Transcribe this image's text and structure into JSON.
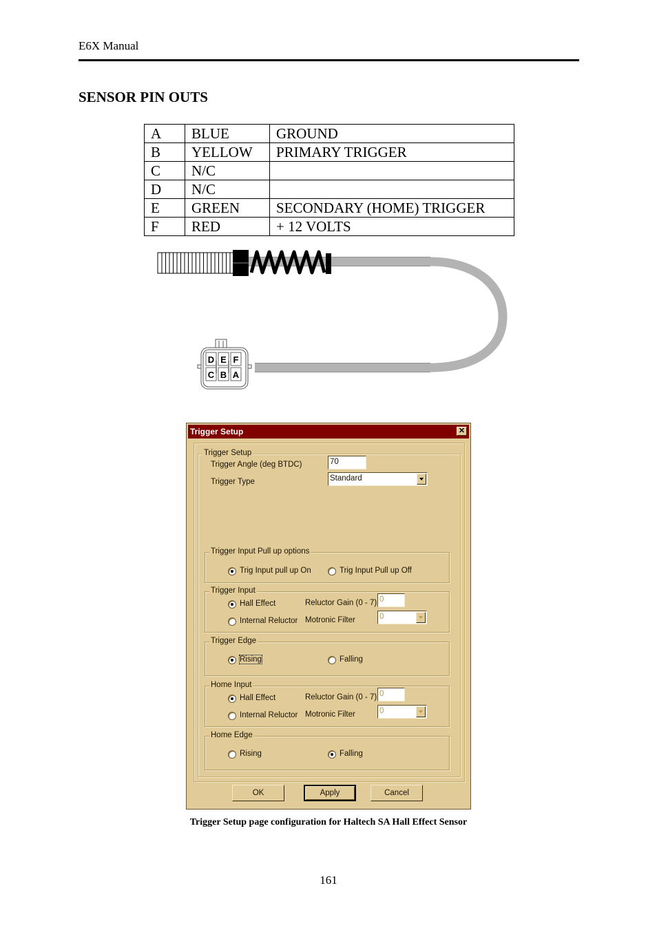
{
  "header": {
    "title": "E6X Manual"
  },
  "section": {
    "title": "SENSOR PIN OUTS"
  },
  "pinout_table": {
    "rows": [
      {
        "pin": "A",
        "color": "BLUE",
        "function": "GROUND"
      },
      {
        "pin": "B",
        "color": "YELLOW",
        "function": "PRIMARY TRIGGER"
      },
      {
        "pin": "C",
        "color": "N/C",
        "function": ""
      },
      {
        "pin": "D",
        "color": "N/C",
        "function": ""
      },
      {
        "pin": "E",
        "color": "GREEN",
        "function": "SECONDARY (HOME) TRIGGER"
      },
      {
        "pin": "F",
        "color": "RED",
        "function": "+ 12 VOLTS"
      }
    ]
  },
  "connector": {
    "top_row": [
      "D",
      "E",
      "F"
    ],
    "bottom_row": [
      "C",
      "B",
      "A"
    ]
  },
  "dialog": {
    "title": "Trigger Setup",
    "title_bar_color": "#800000",
    "face_color": "#e1cc99",
    "close_label": "✕",
    "trigger_setup": {
      "group_label": "Trigger Setup",
      "angle_label": "Trigger Angle (deg BTDC)",
      "angle_value": "70",
      "type_label": "Trigger Type",
      "type_value": "Standard"
    },
    "pullup": {
      "group_label": "Trigger Input Pull up options",
      "on_label": "Trig Input pull up On",
      "off_label": "Trig Input Pull up Off",
      "selected": "on"
    },
    "trigger_input": {
      "group_label": "Trigger Input",
      "hall_label": "Hall Effect",
      "reluctor_label": "Internal Reluctor",
      "selected": "hall",
      "gain_label": "Reluctor Gain (0 - 7)",
      "gain_value": "0",
      "filter_label": "Motronic Filter",
      "filter_value": "0"
    },
    "trigger_edge": {
      "group_label": "Trigger Edge",
      "rising_label": "Rising",
      "falling_label": "Falling",
      "selected": "rising"
    },
    "home_input": {
      "group_label": "Home Input",
      "hall_label": "Hall Effect",
      "reluctor_label": "Internal Reluctor",
      "selected": "hall",
      "gain_label": "Reluctor Gain (0 - 7)",
      "gain_value": "0",
      "filter_label": "Motronic Filter",
      "filter_value": "0"
    },
    "home_edge": {
      "group_label": "Home Edge",
      "rising_label": "Rising",
      "falling_label": "Falling",
      "selected": "falling"
    },
    "buttons": {
      "ok": "OK",
      "apply": "Apply",
      "cancel": "Cancel"
    }
  },
  "caption": "Trigger Setup page configuration for Haltech SA Hall Effect Sensor",
  "page_number": "161"
}
